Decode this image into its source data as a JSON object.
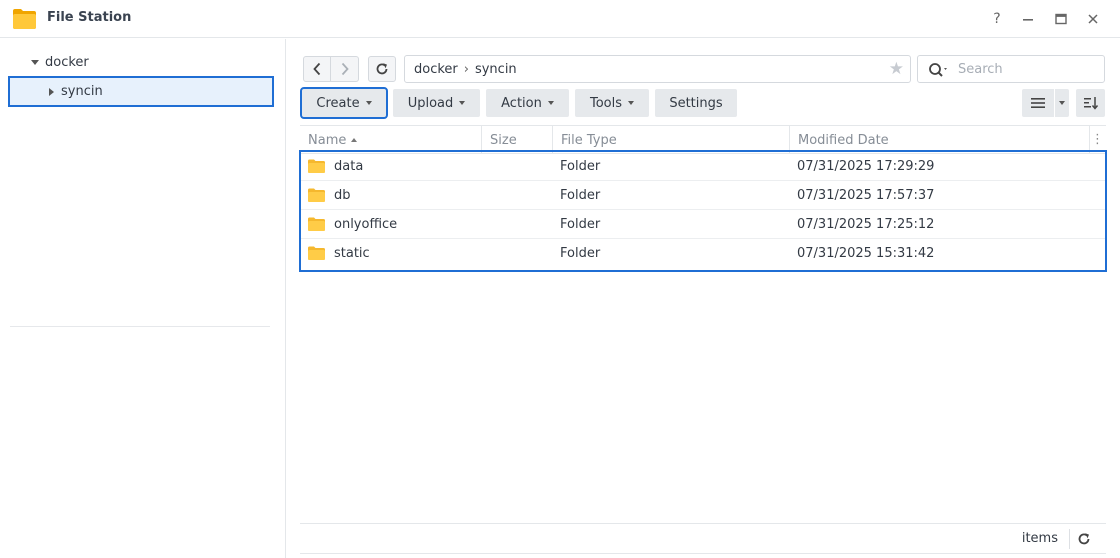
{
  "app": {
    "title": "File Station",
    "icon": "folder-icon"
  },
  "window_controls": {
    "help": "?",
    "minimize": "minimize-icon",
    "maximize": "maximize-icon",
    "close": "close-icon"
  },
  "tree": {
    "root": "docker",
    "child": "syncin"
  },
  "path": {
    "segments": [
      "docker",
      "syncin"
    ],
    "separator": "›"
  },
  "search": {
    "placeholder": "Search"
  },
  "toolbar": {
    "create": "Create",
    "upload": "Upload",
    "action": "Action",
    "tools": "Tools",
    "settings": "Settings"
  },
  "table": {
    "columns": {
      "name": "Name",
      "size": "Size",
      "file_type": "File Type",
      "modified": "Modified Date"
    },
    "rows": [
      {
        "name": "data",
        "size": "",
        "type": "Folder",
        "modified": "07/31/2025 17:29:29"
      },
      {
        "name": "db",
        "size": "",
        "type": "Folder",
        "modified": "07/31/2025 17:57:37"
      },
      {
        "name": "onlyoffice",
        "size": "",
        "type": "Folder",
        "modified": "07/31/2025 17:25:12"
      },
      {
        "name": "static",
        "size": "",
        "type": "Folder",
        "modified": "07/31/2025 15:31:42"
      }
    ]
  },
  "footer": {
    "items_label": "items"
  },
  "colors": {
    "accent": "#1f6ed4",
    "selected_bg": "#e7f1fc",
    "folder": "#f5b82e",
    "button_bg": "#e6e9ec"
  }
}
